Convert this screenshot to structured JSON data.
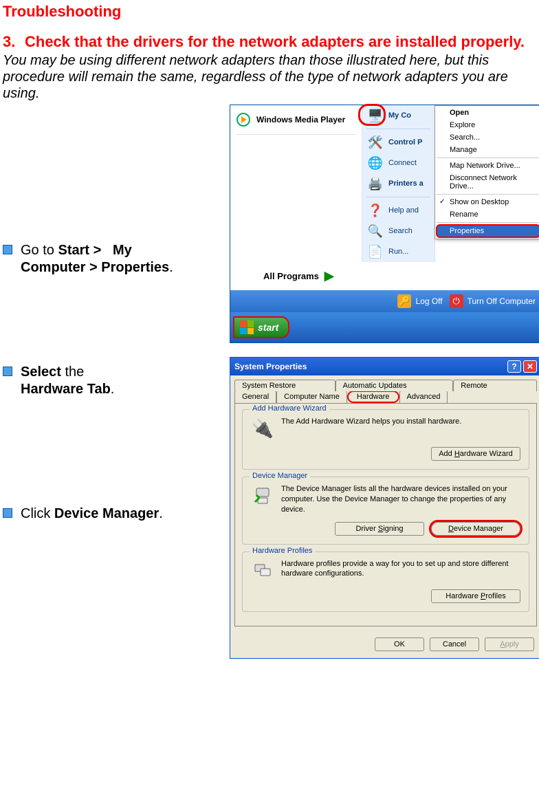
{
  "title": "Troubleshooting",
  "step_number": "3.",
  "step_heading": "Check that the drivers for the network adapters are installed properly.",
  "intro": "You may be using different network adapters than those illustrated here, but this procedure will remain the same, regardless of the type of network adapters you are using.",
  "instructions": {
    "i1_pre": "Go to ",
    "i1_b1": "Start >",
    "i1_mid": "   My ",
    "i1_b2": "Computer > Properties",
    "i1_post": ".",
    "i2_b1": "Select",
    "i2_mid": " the ",
    "i2_b2": "Hardware Tab",
    "i2_post": ".",
    "i3_pre": "Click ",
    "i3_b1": "Device Manager",
    "i3_post": "."
  },
  "startmenu": {
    "wmp": "Windows Media Player",
    "all_programs": "All Programs",
    "right": {
      "mycomputer": "My Co",
      "controlpanel": "Control P",
      "connect": "Connect",
      "printers": "Printers a",
      "help": "Help and",
      "search": "Search",
      "run": "Run..."
    },
    "bottom": {
      "logoff": "Log Off",
      "turnoff": "Turn Off Computer"
    },
    "start": "start"
  },
  "context_menu": {
    "open": "Open",
    "explore": "Explore",
    "search": "Search...",
    "manage": "Manage",
    "map": "Map Network Drive...",
    "disconnect": "Disconnect Network Drive...",
    "show_desktop": "Show on Desktop",
    "rename": "Rename",
    "properties": "Properties"
  },
  "sysprops": {
    "title": "System Properties",
    "tabs": {
      "system_restore": "System Restore",
      "automatic_updates": "Automatic Updates",
      "remote": "Remote",
      "general": "General",
      "computer_name": "Computer Name",
      "hardware": "Hardware",
      "advanced": "Advanced"
    },
    "groups": {
      "add_hw": {
        "legend": "Add Hardware Wizard",
        "text": "The Add Hardware Wizard helps you install hardware.",
        "btn": "Add Hardware Wizard",
        "btn_u": "H"
      },
      "dev_mgr": {
        "legend": "Device Manager",
        "text": "The Device Manager lists all the hardware devices installed on your computer. Use the Device Manager to change the properties of any device.",
        "btn_sign": "Driver Signing",
        "btn_sign_u": "S",
        "btn_dm": "Device Manager",
        "btn_dm_u": "D"
      },
      "hw_profiles": {
        "legend": "Hardware Profiles",
        "text": "Hardware profiles provide a way for you to set up and store different hardware configurations.",
        "btn": "Hardware Profiles",
        "btn_u": "P"
      }
    },
    "footer": {
      "ok": "OK",
      "cancel": "Cancel",
      "apply": "Apply",
      "apply_u": "A"
    }
  }
}
